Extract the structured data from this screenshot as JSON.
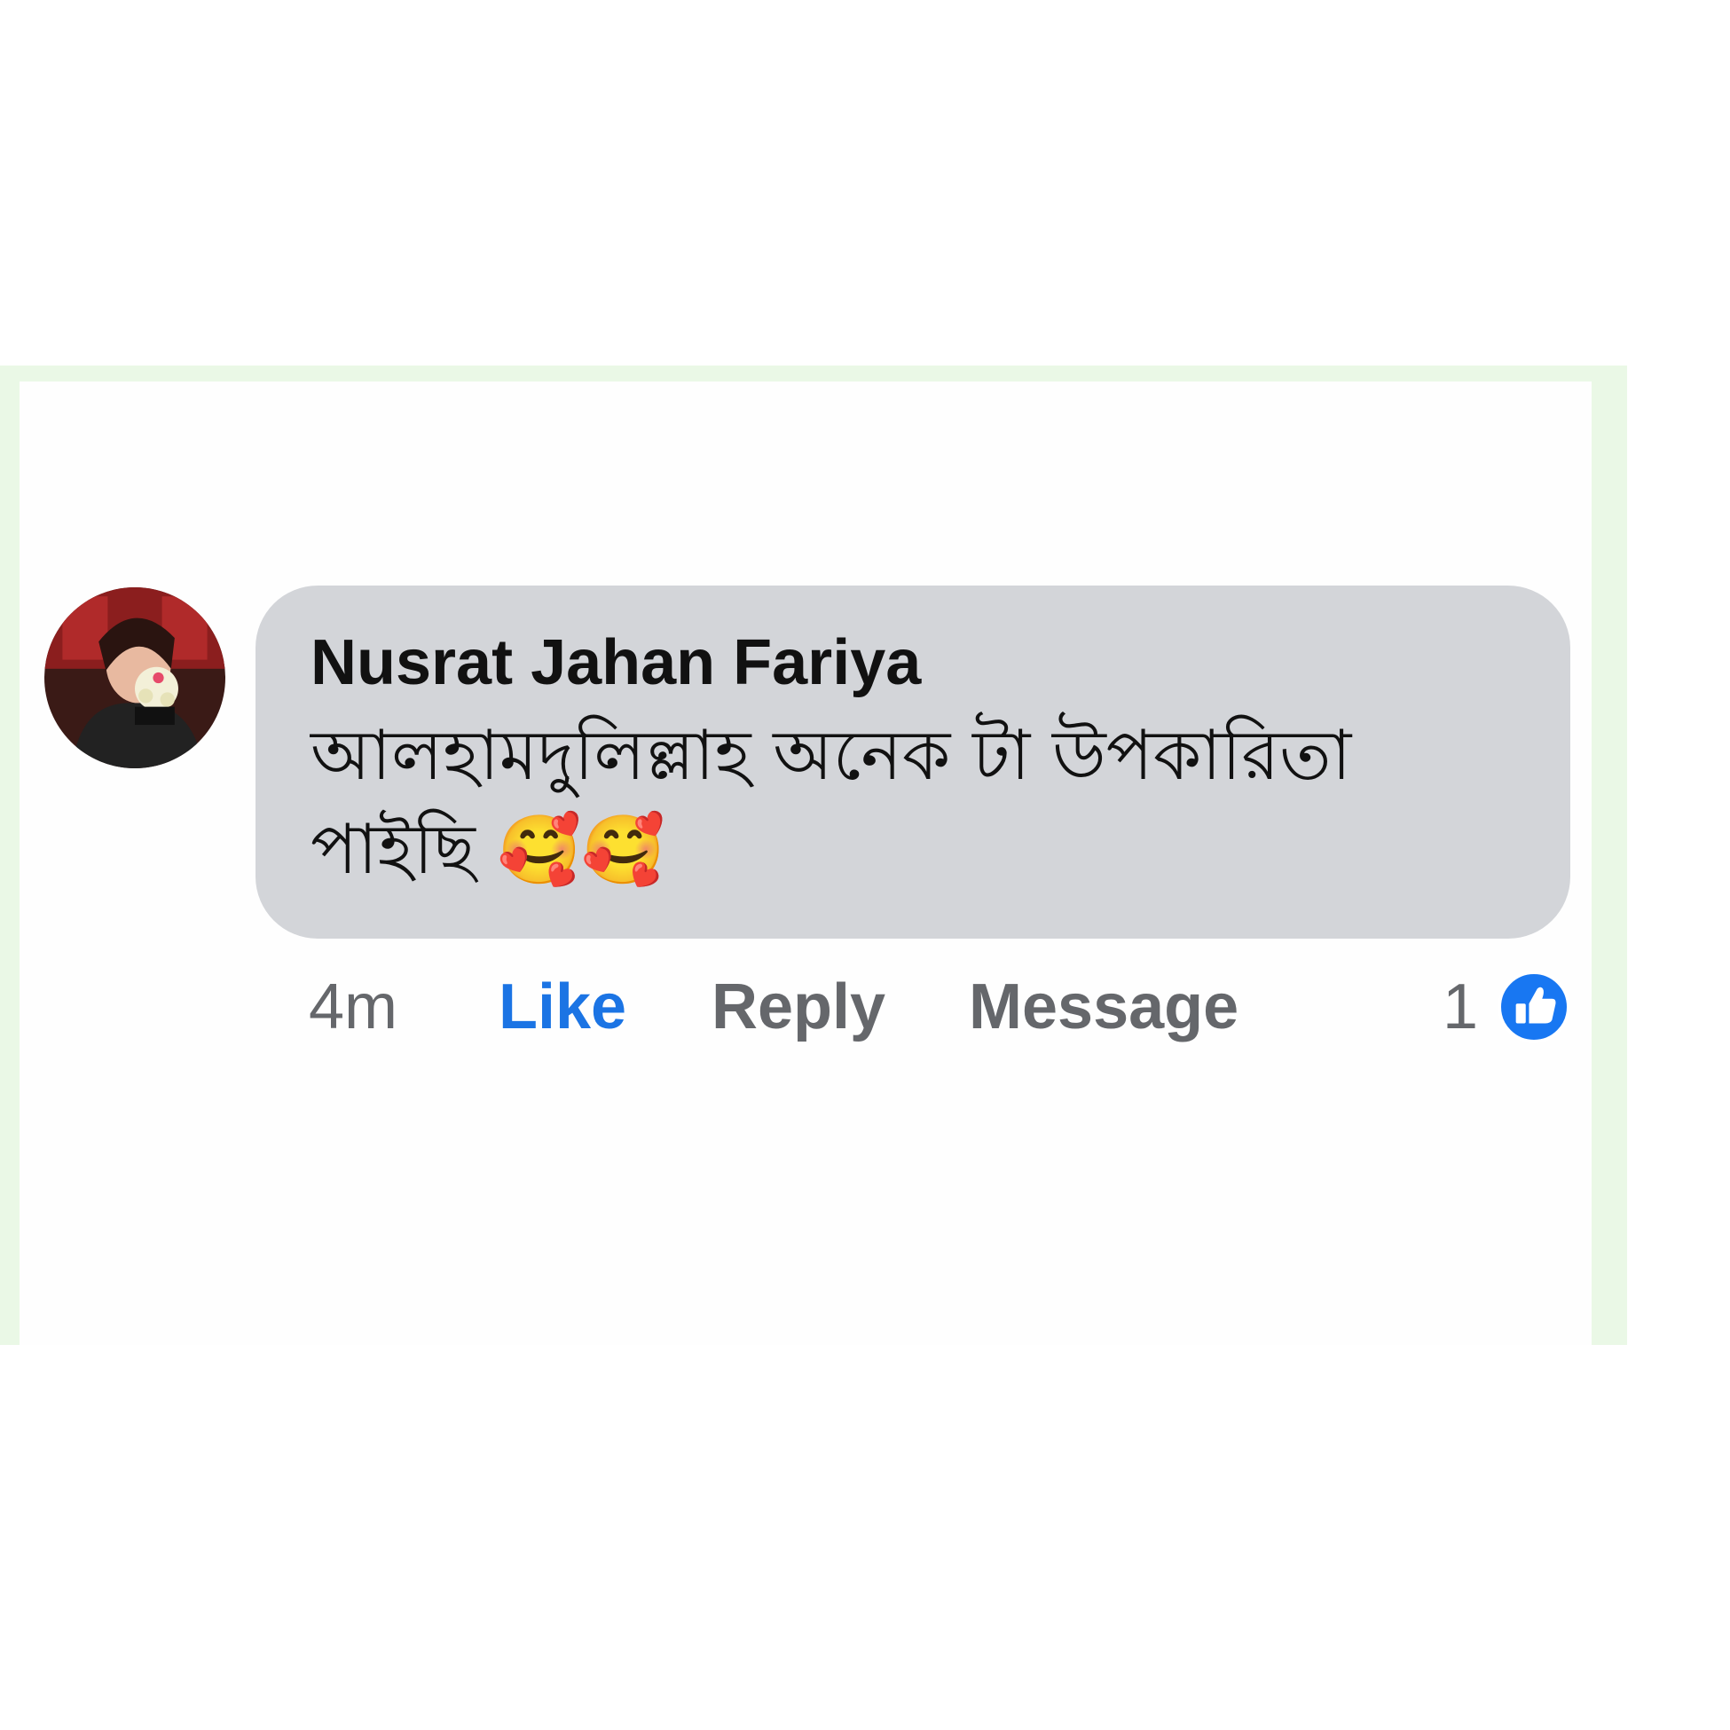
{
  "comment": {
    "author": "Nusrat Jahan Fariya",
    "text": "আলহামদুলিল্লাহ  অনেক  টা উপকারিতা পাইছি",
    "emojis": "🥰🥰"
  },
  "actions": {
    "time": "4m",
    "like_label": "Like",
    "reply_label": "Reply",
    "message_label": "Message",
    "reaction_count": "1",
    "reaction_icon": "thumbs-up-icon"
  },
  "colors": {
    "bubble": "#d3d5d9",
    "like_active": "#1b74e4",
    "secondary_text": "#65676b",
    "reaction_badge": "#1877f2"
  }
}
